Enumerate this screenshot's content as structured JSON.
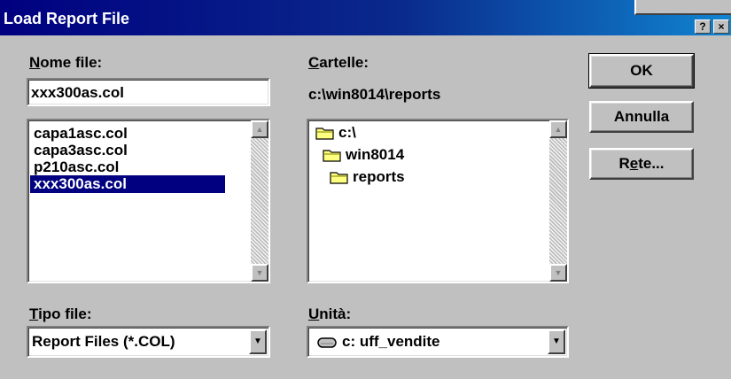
{
  "window": {
    "title": "Load Report File",
    "help_glyph": "?",
    "close_glyph": "×"
  },
  "filename": {
    "label_underline": "N",
    "label_rest": "ome file:",
    "value": "xxx300as.col"
  },
  "files": [
    {
      "name": "capa1asc.col",
      "selected": false
    },
    {
      "name": "capa3asc.col",
      "selected": false
    },
    {
      "name": "p210asc.col",
      "selected": false
    },
    {
      "name": "xxx300as.col",
      "selected": true
    }
  ],
  "folders": {
    "label_underline": "C",
    "label_rest": "artelle:",
    "current_path": "c:\\win8014\\reports",
    "tree": [
      "c:\\",
      "win8014",
      "reports"
    ]
  },
  "buttons": {
    "ok": "OK",
    "cancel": "Annulla",
    "network_pre": "R",
    "network_underline": "e",
    "network_post": "te..."
  },
  "file_type": {
    "label_underline": "T",
    "label_rest": "ipo file:",
    "value": "Report Files (*.COL)"
  },
  "drive": {
    "label_underline": "U",
    "label_rest": "nità:",
    "value": "c: uff_vendite"
  },
  "icons": {
    "scroll_up": "up-arrow",
    "scroll_down": "down-arrow",
    "combo_arrow": "down-triangle",
    "folder": "folder-icon",
    "drive": "hard-drive-icon"
  }
}
